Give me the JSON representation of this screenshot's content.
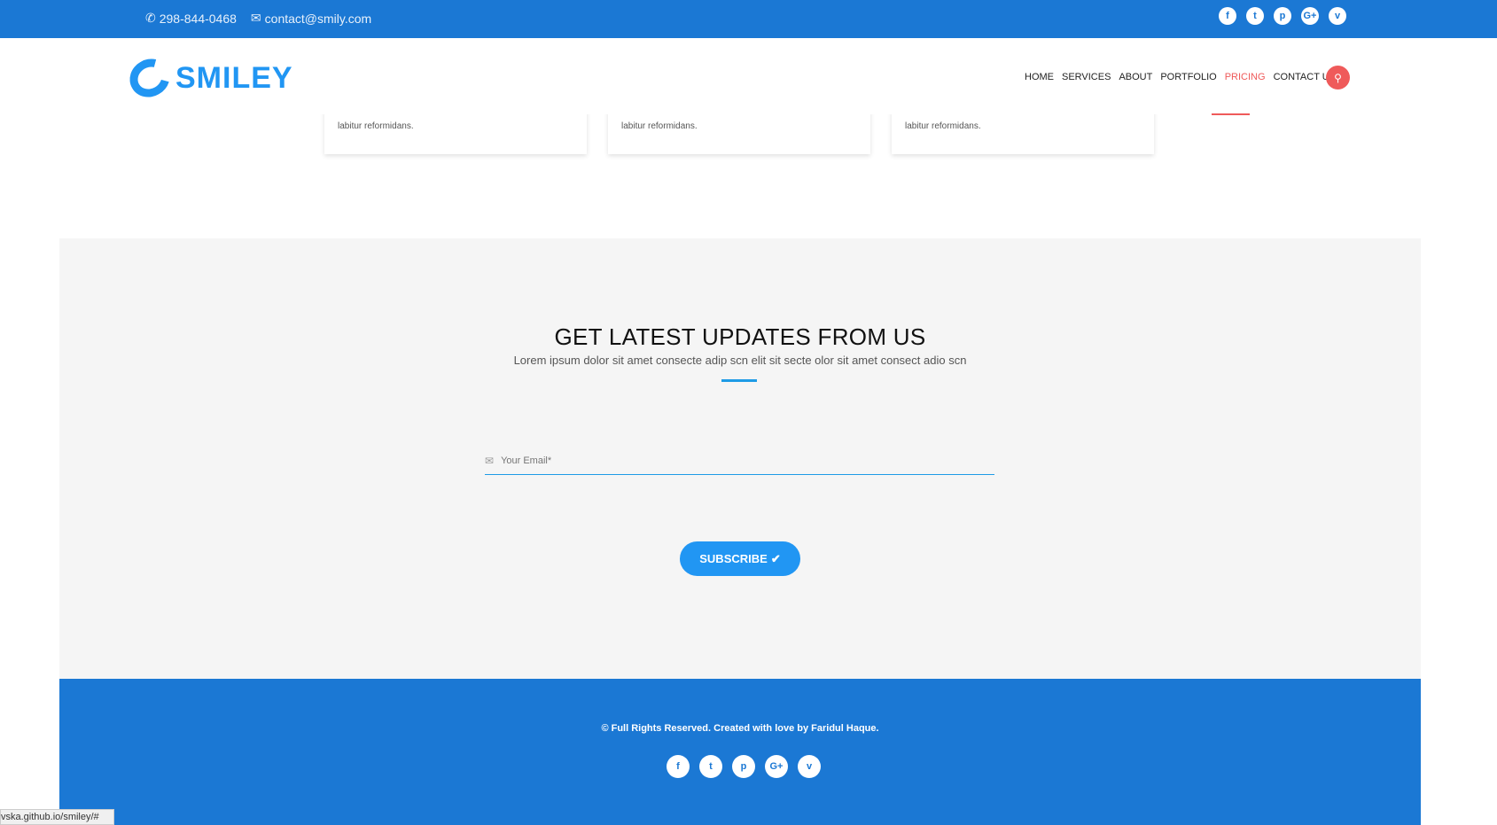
{
  "topbar": {
    "phone": "298-844-0468",
    "email": "contact@smily.com",
    "social": [
      {
        "icon": "facebook-icon",
        "glyph": "f"
      },
      {
        "icon": "twitter-icon",
        "glyph": "t"
      },
      {
        "icon": "pinterest-icon",
        "glyph": "p"
      },
      {
        "icon": "google-plus-icon",
        "glyph": "G+"
      },
      {
        "icon": "vimeo-icon",
        "glyph": "v"
      }
    ]
  },
  "header": {
    "logo": "SMILEY",
    "nav": [
      "HOME",
      "SERVICES",
      "ABOUT",
      "PORTFOLIO",
      "PRICING",
      "CONTACT US"
    ],
    "active": "PRICING"
  },
  "cards": [
    "labitur reformidans.",
    "labitur reformidans.",
    "labitur reformidans."
  ],
  "newsletter": {
    "title": "GET LATEST UPDATES FROM US",
    "subtitle": "Lorem ipsum dolor sit amet consecte adip scn elit sit secte olor sit amet consect adio scn",
    "placeholder": "Your Email*",
    "button": "SUBSCRIBE"
  },
  "footer": {
    "copyright": "© Full Rights Reserved. Created with love by Faridul Haque."
  },
  "status_url": "vska.github.io/smiley/#",
  "colors": {
    "primary": "#1b78d4",
    "accent": "#2196f3",
    "highlight": "#ef5a5a",
    "section_bg": "#f5f5f5"
  }
}
